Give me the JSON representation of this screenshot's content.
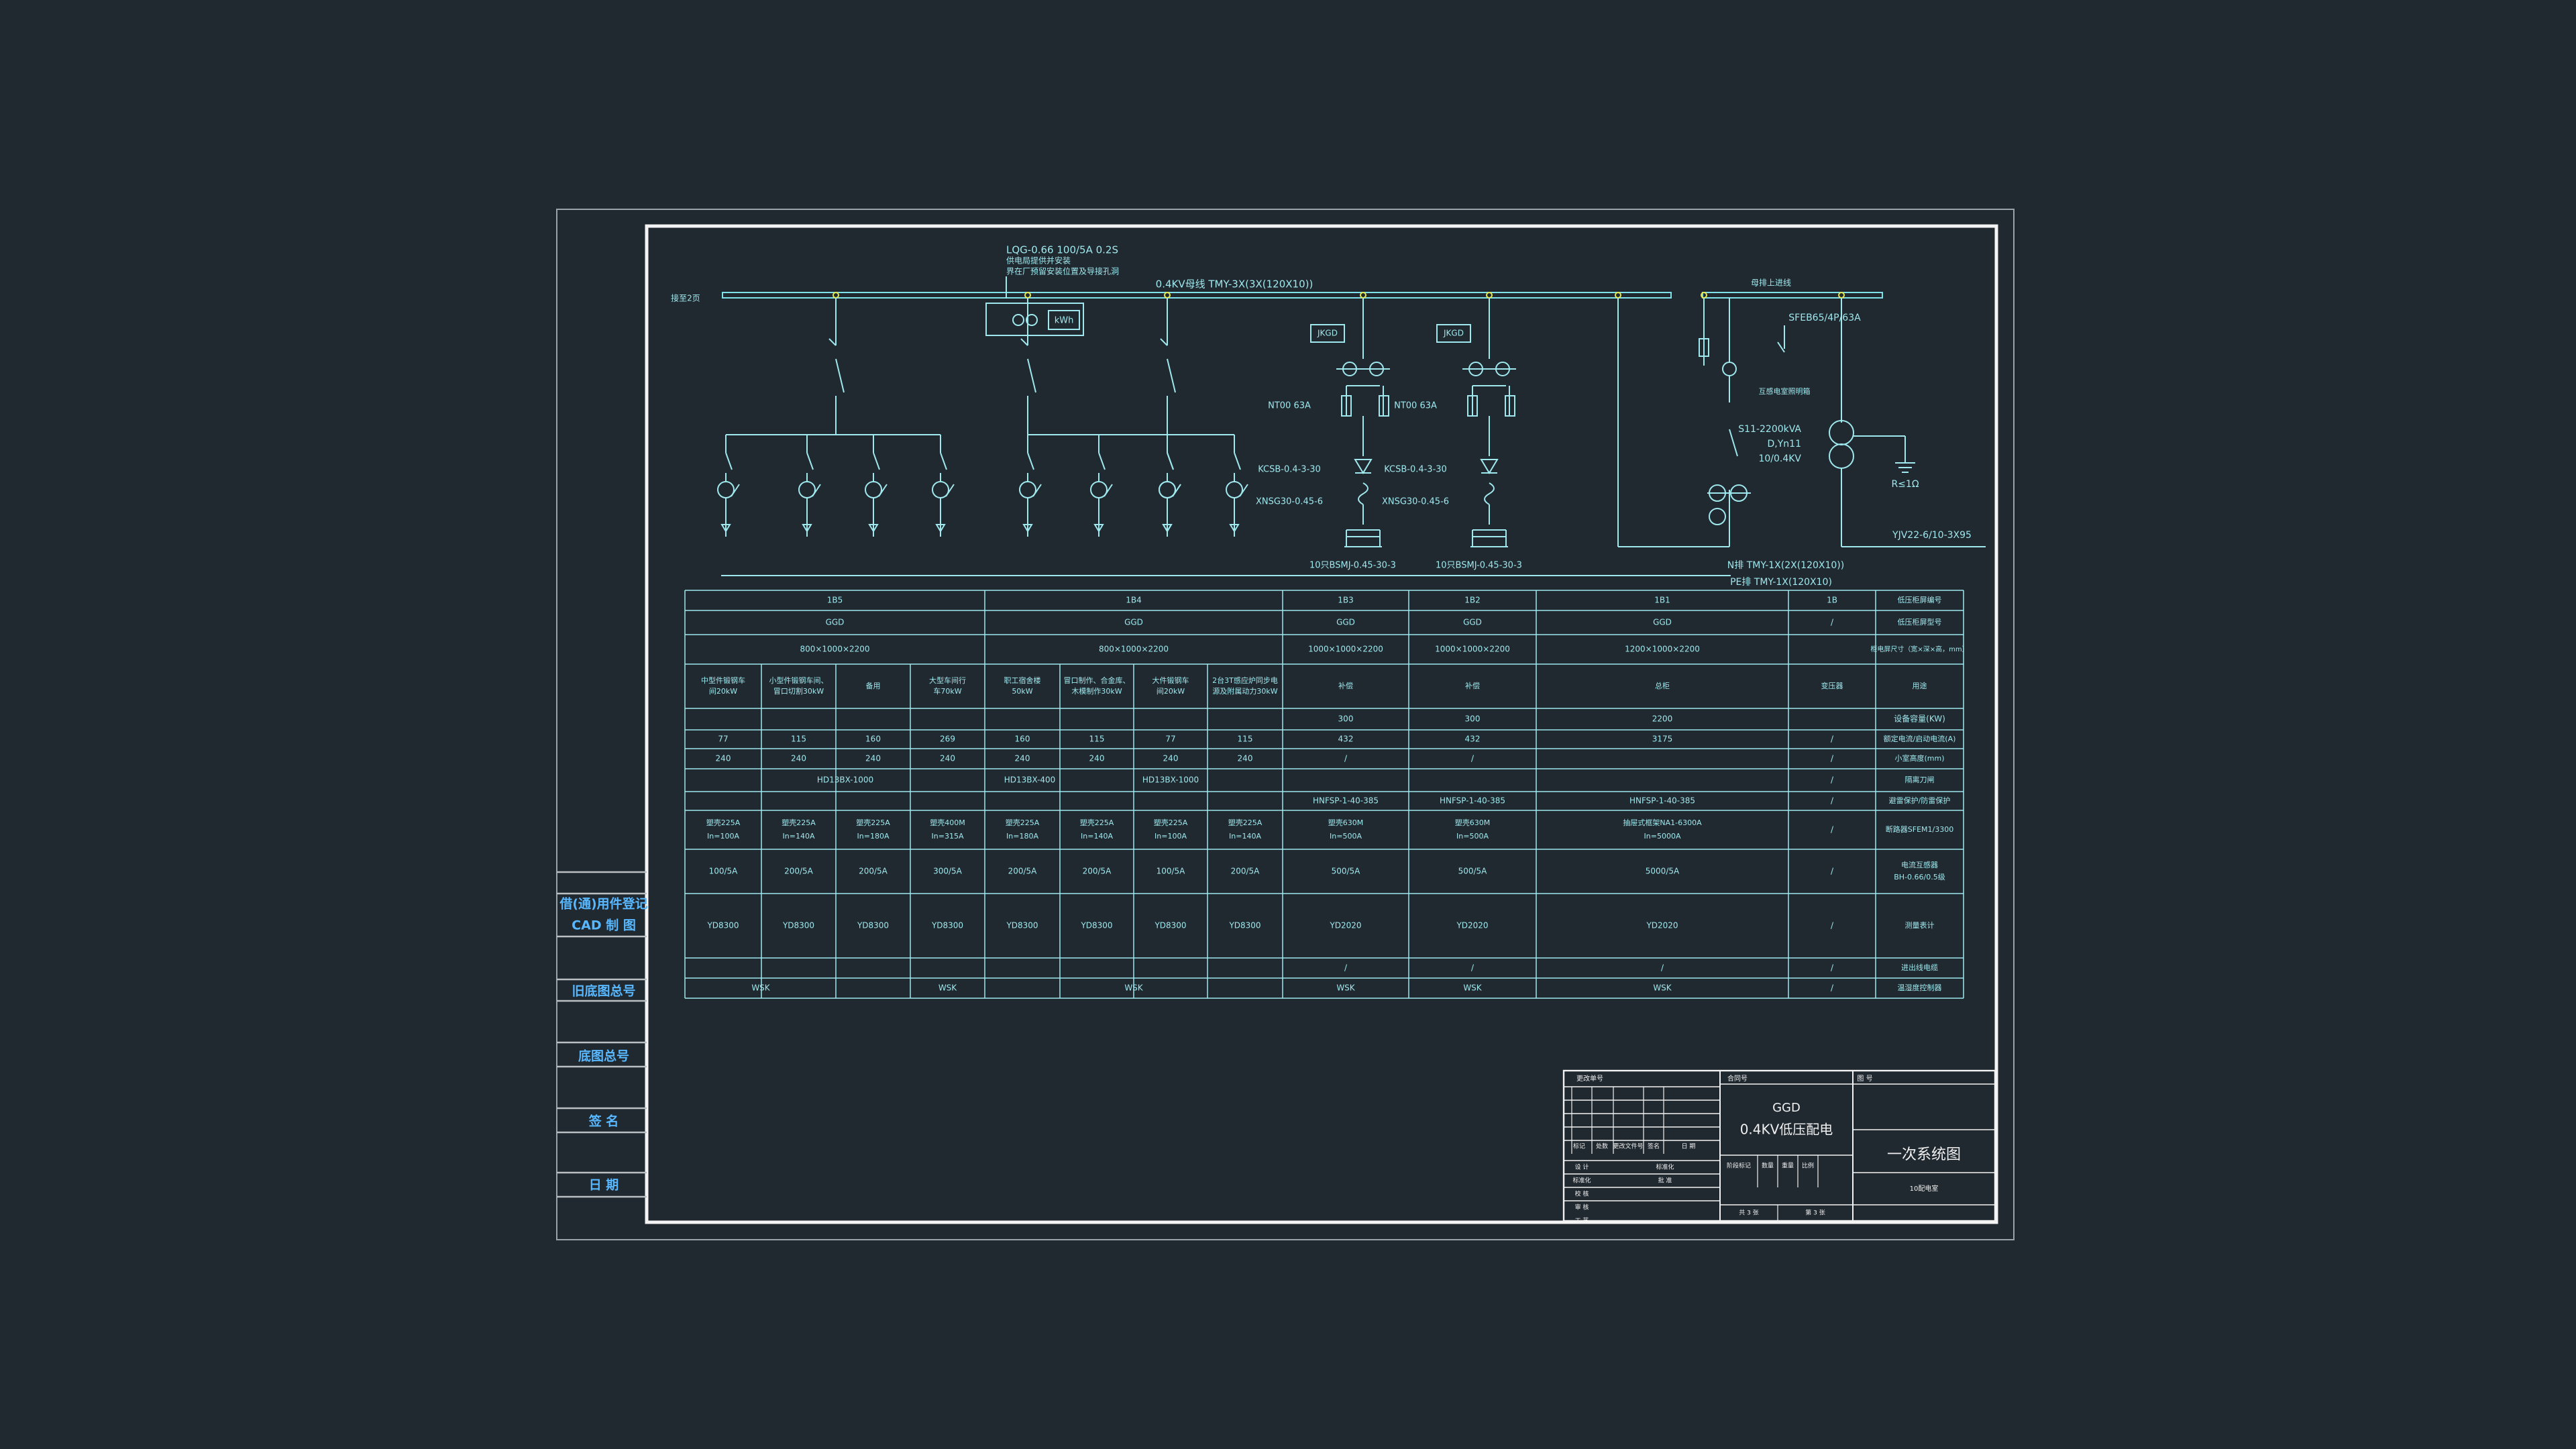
{
  "drawing": {
    "colors": {
      "background": "#212930",
      "frame": "#f2f2f2",
      "line": "#9ee8ee",
      "label": "#58b8ff",
      "busbar": "#7ee0e8",
      "node": "#e6e64a"
    },
    "schematic": {
      "ct_note": [
        "LQG-0.66  100/5A  0.2S",
        "供电局提供并安装",
        "界在厂预留安装位置及导接孔洞"
      ],
      "meter_label": "kWh",
      "bus_left_label": "接至2页",
      "busbar_label": "0.4KV母线  TMY-3X(3X(120X10))",
      "bus_right_label": "母排上进线",
      "jkgd": [
        "JKGD",
        "JKGD"
      ],
      "fuse": [
        "NT00  63A",
        "NT00  63A"
      ],
      "switch": [
        "KCSB-0.4-3-30",
        "KCSB-0.4-3-30"
      ],
      "reactor": [
        "XNSG30-0.45-6",
        "XNSG30-0.45-6"
      ],
      "capacitor": [
        "10只BSMJ-0.45-30-3",
        "10只BSMJ-0.45-30-3"
      ],
      "breaker_right": "SFEB65/4P/63A",
      "meter_note": "互感电室照明箱",
      "transformer": [
        "S11-2200kVA",
        "D,Yn11",
        "10/0.4KV"
      ],
      "ground": "R≤1Ω",
      "cable": "YJV22-6/10-3X95",
      "n_bar": "N排  TMY-1X(2X(120X10))",
      "pe_bar": "PE排  TMY-1X(120X10)"
    },
    "table": {
      "cabinet": [
        "1B5",
        "1B4",
        "1B3",
        "1B2",
        "1B1",
        "1B",
        "低压柜屏编号"
      ],
      "type": [
        "GGD",
        "GGD",
        "GGD",
        "GGD",
        "GGD",
        "/",
        "低压柜屏型号"
      ],
      "size": [
        "800×1000×2200",
        "800×1000×2200",
        "1000×1000×2200",
        "1000×1000×2200",
        "1200×1000×2200",
        "",
        "柜电屏尺寸（宽×深×高，mm）"
      ],
      "usage": [
        [
          "中型件锻钢车间20kW",
          "小型件锻钢车间、冒口切割30kW",
          "备用",
          "大型车间行车70kW"
        ],
        [
          "职工宿舍楼50kW",
          "冒口制作、合金库、木模制作30kW",
          "大件锻钢车间20kW",
          "2台3T感应炉同步电源及附属动力30kW"
        ],
        "补偿",
        "补偿",
        "总柜",
        "变压器",
        "用途"
      ],
      "capacity": [
        "300",
        "300",
        "2200",
        "",
        "设备容量(KW)"
      ],
      "current": [
        [
          "77",
          "115",
          "160",
          "269"
        ],
        [
          "160",
          "115",
          "77",
          "115"
        ],
        "432",
        "432",
        "3175",
        "/",
        "额定电流/启动电流(A)"
      ],
      "section": [
        [
          "240",
          "240",
          "240",
          "240"
        ],
        [
          "240",
          "240",
          "240",
          "240"
        ],
        "/",
        "/",
        "",
        "/",
        "小室高度(mm)"
      ],
      "knife": [
        "HD13BX-1000",
        "HD13BX-400",
        "HD13BX-1000",
        "",
        "",
        "",
        "/",
        "隔离刀闸"
      ],
      "fusegear": [
        "HNFSP-1-40-385",
        "HNFSP-1-40-385",
        "HNFSP-1-40-385",
        "/",
        "避雷保护/防雷保护"
      ],
      "breaker": [
        [
          [
            "塑壳225A",
            "In=100A"
          ],
          [
            "塑壳225A",
            "In=140A"
          ],
          [
            "塑壳225A",
            "In=180A"
          ],
          [
            "塑壳400M",
            "In=315A"
          ]
        ],
        [
          [
            "塑壳225A",
            "In=180A"
          ],
          [
            "塑壳225A",
            "In=140A"
          ],
          [
            "塑壳225A",
            "In=100A"
          ],
          [
            "塑壳225A",
            "In=140A"
          ]
        ],
        [
          "塑壳630M",
          "In=500A"
        ],
        [
          "塑壳630M",
          "In=500A"
        ],
        [
          "抽屉式框架NA1-6300A",
          "In=5000A"
        ],
        "/",
        "断路器SFEM1/3300"
      ],
      "ct": [
        [
          "100/5A",
          "200/5A",
          "200/5A",
          "300/5A"
        ],
        [
          "200/5A",
          "200/5A",
          "100/5A",
          "200/5A"
        ],
        "500/5A",
        "500/5A",
        "5000/5A",
        "/",
        [
          "电流互感器",
          "BH-0.66/0.5级"
        ]
      ],
      "meter": [
        [
          "YD8300",
          "YD8300",
          "YD8300",
          "YD8300"
        ],
        [
          "YD8300",
          "YD8300",
          "YD8300",
          "YD8300"
        ],
        "YD2020",
        "YD2020",
        "YD2020",
        "/",
        "测量表计"
      ],
      "inline": [
        "/",
        "/",
        "/",
        "/",
        "进出线电缆"
      ],
      "wsk": [
        "WSK",
        "WSK",
        "WSK",
        "WSK",
        "WSK",
        "WSK",
        "/",
        "温湿度控制器"
      ]
    },
    "sidebar": [
      "借(通)用件登记",
      "CAD 制 图",
      "旧底图总号",
      "底图总号",
      "签  名",
      "日  期"
    ],
    "titleblock": {
      "project": "GGD",
      "name": "0.4KV低压配电",
      "drawing": "一次系统图",
      "designer_row": [
        "设 计",
        "标准化",
        "校 核",
        "审 核",
        "工 艺"
      ],
      "head_left": "更改单号",
      "head_mid": "合同号",
      "head_right": "图 号",
      "cols": [
        "标记",
        "处数",
        "更改文件号",
        "签名",
        "日 期"
      ],
      "mid_cols": [
        "阶段标记",
        "数量",
        "重量",
        "比例"
      ],
      "approve": "批 准",
      "sheet_total": "共 3 张",
      "sheet_no": "第 3 张",
      "company": "10配电室"
    }
  }
}
